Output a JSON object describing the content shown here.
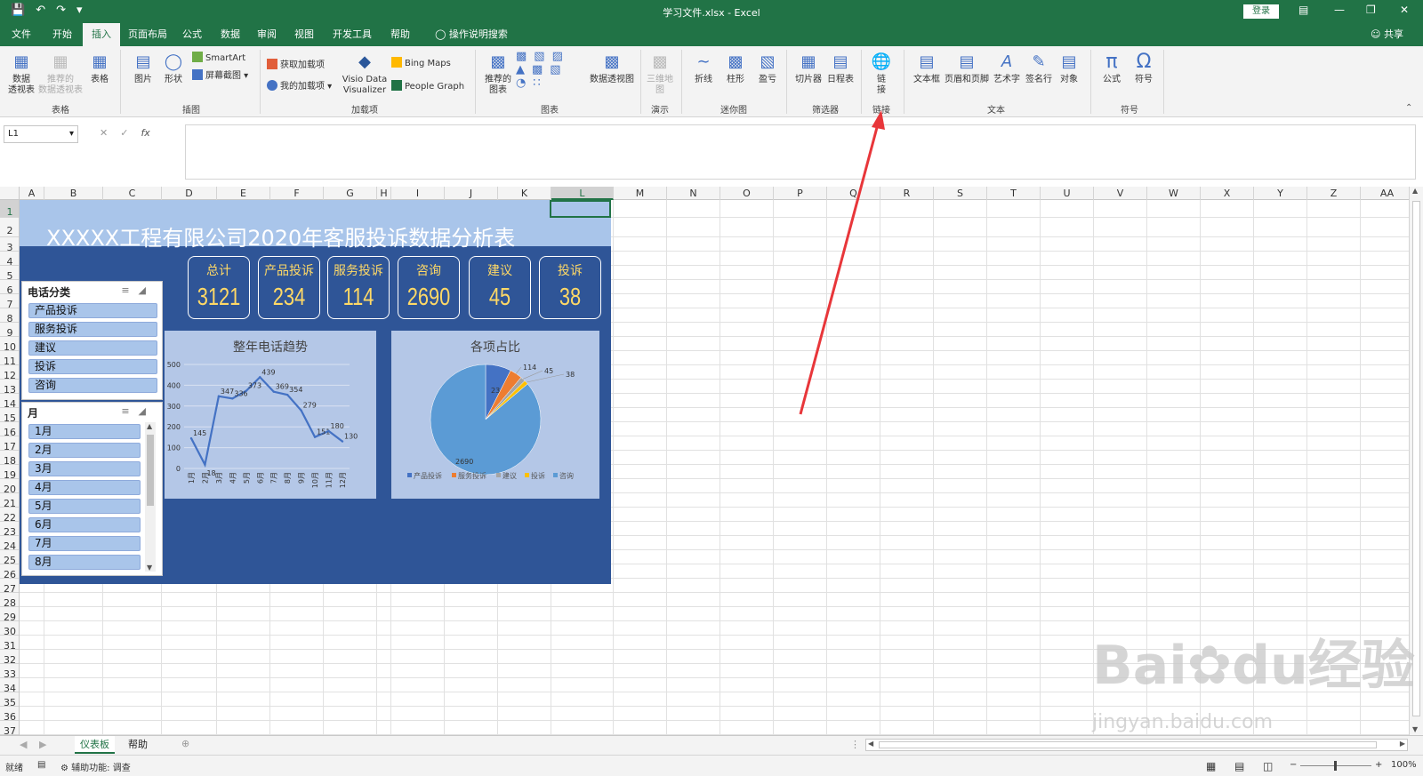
{
  "window": {
    "title": "学习文件.xlsx  -  Excel",
    "login_label": "登录",
    "share_label": "共享"
  },
  "ribbon_tabs": [
    "文件",
    "开始",
    "插入",
    "页面布局",
    "公式",
    "数据",
    "审阅",
    "视图",
    "开发工具",
    "帮助",
    "操作说明搜索"
  ],
  "active_tab": "插入",
  "ribbon": {
    "groups": {
      "tables": "表格",
      "illustrations": "插图",
      "addins": "加载项",
      "charts": "图表",
      "tours": "演示",
      "sparklines": "迷你图",
      "filters": "筛选器",
      "links": "链接",
      "text": "文本",
      "symbols": "符号"
    },
    "buttons": {
      "pivot": "数据\n透视表",
      "rec_pivot": "推荐的\n数据透视表",
      "table": "表格",
      "pictures": "图片",
      "shapes": "形状",
      "smartart": "SmartArt",
      "screenshot": "屏幕截图",
      "get_addins": "获取加载项",
      "my_addins": "我的加载项",
      "visio": "Visio Data\nVisualizer",
      "bing_maps": "Bing Maps",
      "people_graph": "People Graph",
      "rec_charts": "推荐的\n图表",
      "pivot_chart": "数据透视图",
      "map3d": "三维地\n图",
      "line": "折线",
      "column": "柱形",
      "winloss": "盈亏",
      "slicer": "切片器",
      "timeline": "日程表",
      "link": "链\n接",
      "textbox": "文本框",
      "header_footer": "页眉和页脚",
      "wordart": "艺术字",
      "signature": "签名行",
      "object": "对象",
      "equation": "公式",
      "symbol": "符号"
    }
  },
  "formula_bar": {
    "name_box": "L1",
    "fx": "fx",
    "value": ""
  },
  "columns": [
    "A",
    "B",
    "C",
    "D",
    "E",
    "F",
    "G",
    "H",
    "I",
    "J",
    "K",
    "L",
    "M",
    "N",
    "O",
    "P",
    "Q",
    "R",
    "S",
    "T",
    "U",
    "V",
    "W",
    "X",
    "Y",
    "Z",
    "AA"
  ],
  "rows": [
    "1",
    "2",
    "3",
    "4",
    "5",
    "6",
    "7",
    "8",
    "9",
    "10",
    "11",
    "12",
    "13",
    "14",
    "15",
    "16",
    "17",
    "18",
    "19",
    "20",
    "21",
    "22",
    "23",
    "24",
    "25",
    "26",
    "27",
    "28",
    "29",
    "30",
    "31",
    "32",
    "33",
    "34",
    "35",
    "36",
    "37"
  ],
  "selected_cell": "L1",
  "dashboard": {
    "title": "XXXXX工程有限公司2020年客服投诉数据分析表",
    "kpis": [
      {
        "label": "总计",
        "value": "3121"
      },
      {
        "label": "产品投诉",
        "value": "234"
      },
      {
        "label": "服务投诉",
        "value": "114"
      },
      {
        "label": "咨询",
        "value": "2690"
      },
      {
        "label": "建议",
        "value": "45"
      },
      {
        "label": "投诉",
        "value": "38"
      }
    ],
    "slicer1": {
      "header": "电话分类",
      "items": [
        "产品投诉",
        "服务投诉",
        "建议",
        "投诉",
        "咨询"
      ]
    },
    "slicer2": {
      "header": "月",
      "items": [
        "1月",
        "2月",
        "3月",
        "4月",
        "5月",
        "6月",
        "7月",
        "8月"
      ]
    }
  },
  "chart_data": [
    {
      "type": "line",
      "title": "整年电话趋势",
      "categories": [
        "1月",
        "2月",
        "3月",
        "4月",
        "5月",
        "6月",
        "7月",
        "8月",
        "9月",
        "10月",
        "11月",
        "12月"
      ],
      "values": [
        145,
        18,
        347,
        336,
        373,
        439,
        369,
        354,
        279,
        151,
        180,
        130
      ],
      "ylim": [
        0,
        500
      ],
      "yticks": [
        0,
        100,
        200,
        300,
        400,
        500
      ],
      "color": "#4472c4"
    },
    {
      "type": "pie",
      "title": "各项占比",
      "labels": [
        "产品投诉",
        "服务投诉",
        "建议",
        "投诉",
        "咨询"
      ],
      "values": [
        234,
        114,
        45,
        38,
        2690
      ],
      "colors": [
        "#4472c4",
        "#ed7d31",
        "#a5a5a5",
        "#ffc000",
        "#5b9bd5"
      ],
      "legend": "bottom"
    }
  ],
  "sheet_tabs": [
    "仪表板",
    "帮助"
  ],
  "active_sheet": "仪表板",
  "status": {
    "ready": "就绪",
    "accessibility": "辅助功能: 调查",
    "zoom": "100%"
  },
  "watermark": {
    "brand": "Bai",
    "brand2": "du经验",
    "url": "jingyan.baidu.com"
  }
}
